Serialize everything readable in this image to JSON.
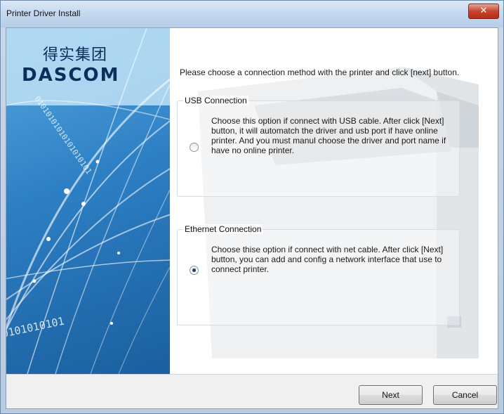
{
  "window": {
    "title": "Printer Driver Install",
    "close_glyph": "✕",
    "close_icon": "close-icon"
  },
  "logo": {
    "chinese_text": "得实集团",
    "brand_text": "DASCOM"
  },
  "intro_text": "Please choose a connection method with the printer and click [next] button.",
  "options": {
    "usb": {
      "legend": "USB Connection",
      "description": "Choose this option if connect with USB cable. After click [Next] button, it will automatch the driver and usb port if have online printer. And you must manul choose the driver and port name if have no online printer.",
      "selected": false
    },
    "ethernet": {
      "legend": "Ethernet Connection",
      "description": "Choose thise option if connect with net cable. After click [Next] button, you can add and config a network interface that use to connect printer.",
      "selected": true
    }
  },
  "buttons": {
    "next_label": "Next",
    "cancel_label": "Cancel"
  },
  "decor": {
    "binary_text_1": "01010101010101010101",
    "binary_text_2": "0101010101"
  },
  "colors": {
    "title_bar": "#c4d7ee",
    "close_button": "#c7432f",
    "brand_blue": "#0b2e5a",
    "panel_blue": "#2d7fc4"
  }
}
